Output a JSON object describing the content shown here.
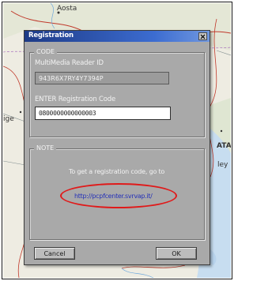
{
  "map": {
    "labels": {
      "city_top": "Aosta",
      "label_right_mid": "ATA",
      "label_right_mid2": "ley",
      "label_left": "ige"
    }
  },
  "dialog": {
    "title": "Registration",
    "close_glyph": "×",
    "code_section": {
      "title": "CODE",
      "reader_id_label": "MultiMedia Reader ID",
      "reader_id_value": "943R6X7RY4Y7394P",
      "registration_label": "ENTER Registration Code",
      "registration_value": "0800000000000003"
    },
    "note_section": {
      "title": "NOTE",
      "text": "To get a registration code, go to",
      "link": "http://pcpfcenter.svrvap.it/"
    },
    "buttons": {
      "cancel": "Cancel",
      "ok": "OK"
    }
  },
  "colors": {
    "dialog_bg": "#a9a9a9",
    "titlebar": "#1d3a86",
    "highlight": "#e01a1a",
    "link": "#2430b8"
  }
}
